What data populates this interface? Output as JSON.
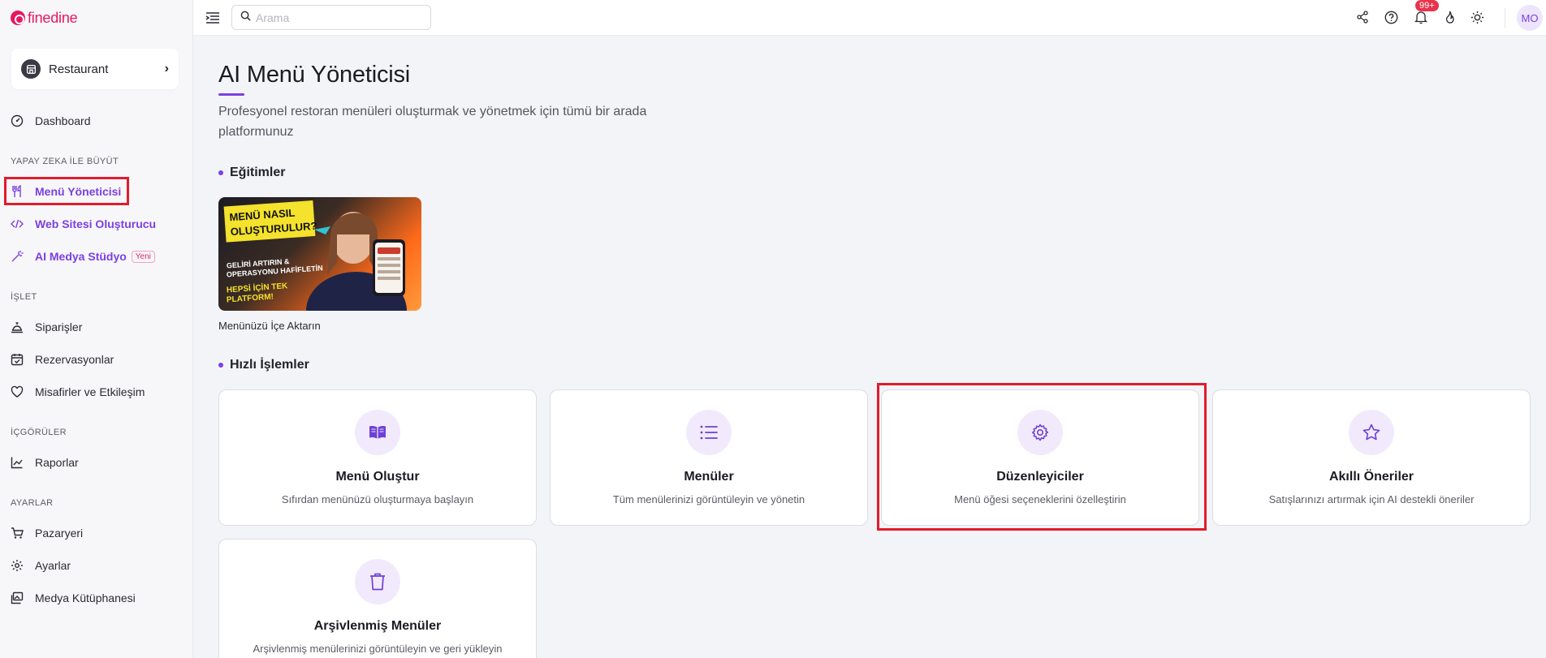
{
  "brand": {
    "name": "finedine"
  },
  "restaurant": {
    "label": "Restaurant"
  },
  "nav": {
    "dashboard": "Dashboard",
    "section_ai": "YAPAY ZEKA İLE BÜYÜT",
    "menu_manager": "Menü Yöneticisi",
    "website_builder": "Web Sitesi Oluşturucu",
    "media_studio": "AI Medya Stüdyo",
    "new_badge": "Yeni",
    "section_business": "İŞLET",
    "orders": "Siparişler",
    "reservations": "Rezervasyonlar",
    "guests": "Misafirler ve Etkileşim",
    "section_insights": "İÇGÖRÜLER",
    "reports": "Raporlar",
    "section_settings": "AYARLAR",
    "marketplace": "Pazaryeri",
    "settings": "Ayarlar",
    "media_library": "Medya Kütüphanesi"
  },
  "topbar": {
    "search_placeholder": "Arama",
    "notification_count": "99+",
    "avatar_initials": "MO"
  },
  "page": {
    "title": "AI Menü Yöneticisi",
    "subtitle": "Profesyonel restoran menüleri oluşturmak ve yönetmek için tümü bir arada platformunuz"
  },
  "tutorials": {
    "heading": "Eğitimler",
    "video": {
      "caption": "Menünüzü İçe Aktarın",
      "thumb_line1": "MENÜ NASIL",
      "thumb_line2": "OLUŞTURULUR?",
      "thumb_line3": "GELİRİ ARTIRIN &",
      "thumb_line4": "OPERASYONU HAFİFLETİN",
      "thumb_line5": "HEPSİ İÇİN TEK",
      "thumb_line6": "PLATFORM!"
    }
  },
  "quick_actions": {
    "heading": "Hızlı İşlemler",
    "cards": [
      {
        "title": "Menü Oluştur",
        "desc": "Sıfırdan menünüzü oluşturmaya başlayın",
        "icon": "book-icon"
      },
      {
        "title": "Menüler",
        "desc": "Tüm menülerinizi görüntüleyin ve yönetin",
        "icon": "list-icon"
      },
      {
        "title": "Düzenleyiciler",
        "desc": "Menü öğesi seçeneklerini özelleştirin",
        "icon": "gear-icon"
      },
      {
        "title": "Akıllı Öneriler",
        "desc": "Satışlarınızı artırmak için AI destekli öneriler",
        "icon": "star-icon"
      },
      {
        "title": "Arşivlenmiş Menüler",
        "desc": "Arşivlenmiş menülerinizi görüntüleyin ve geri yükleyin",
        "icon": "trash-icon"
      }
    ]
  },
  "colors": {
    "accent": "#7b3fe4",
    "brand": "#e8175d",
    "highlight": "#e21b2c"
  }
}
